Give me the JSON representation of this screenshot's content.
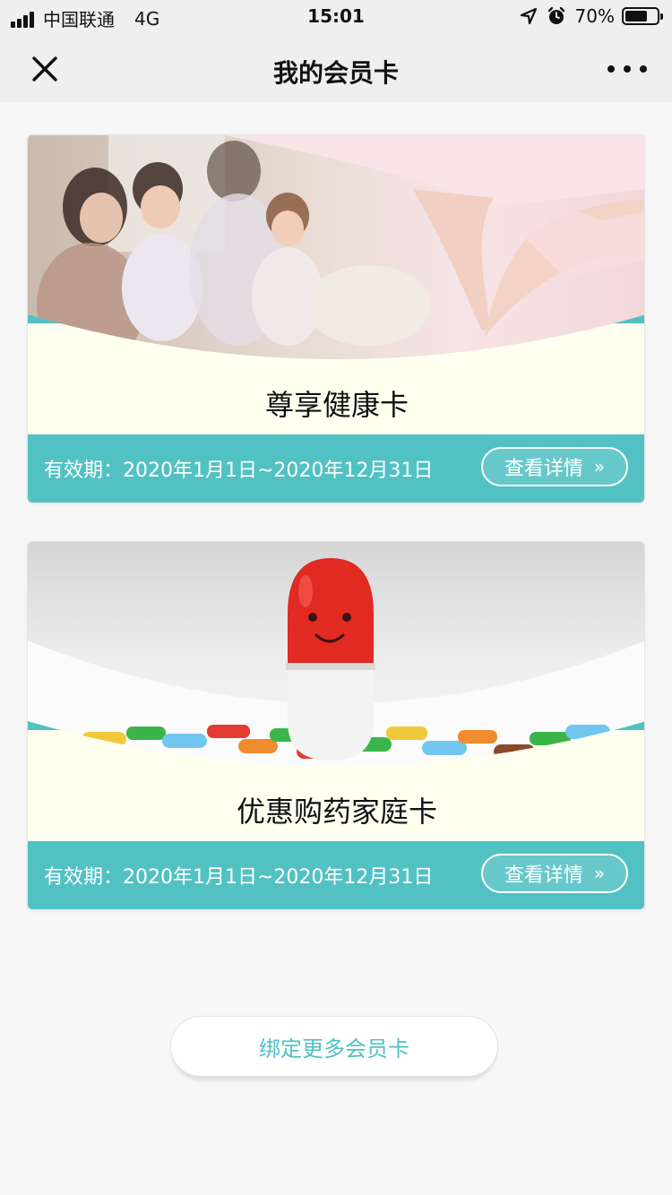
{
  "status_bar": {
    "carrier": "中国联通",
    "network": "4G",
    "time": "15:01",
    "battery_percent": "70%",
    "battery_level": 0.7
  },
  "nav": {
    "title": "我的会员卡",
    "close_icon": "close-icon",
    "more_icon": "more-icon"
  },
  "cards": [
    {
      "name": "尊享健康卡",
      "validity": "有效期：2020年1月1日~2020年12月31日",
      "detail_label": "查看详情",
      "detail_arrow": "»",
      "image": "family-heart-hands-photo"
    },
    {
      "name": "优惠购药家庭卡",
      "validity": "有效期：2020年1月1日~2020年12月31日",
      "detail_label": "查看详情",
      "detail_arrow": "»",
      "image": "smiling-capsule-photo"
    }
  ],
  "bind_button": {
    "label": "绑定更多会员卡"
  },
  "colors": {
    "accent": "#52c1c3",
    "card_bg": "#fffff0",
    "page_bg": "#f7f7f7",
    "nav_bg": "#efefef"
  }
}
